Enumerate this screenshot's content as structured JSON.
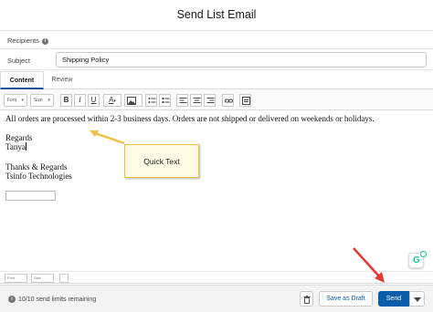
{
  "header": {
    "title": "Send List Email"
  },
  "recipients": {
    "label": "Recipients",
    "info_icon": "i"
  },
  "subject": {
    "label": "Subject",
    "value": "Shipping Policy"
  },
  "tabs": [
    {
      "label": "Content",
      "active": true
    },
    {
      "label": "Review",
      "active": false
    }
  ],
  "toolbar": {
    "font_select": "Font",
    "size_select": "Size",
    "bold": "B",
    "italic": "I",
    "underline": "U",
    "font_color": "A",
    "icons": [
      "image-icon",
      "bullet-list-icon",
      "numbered-list-icon",
      "align-left-icon",
      "align-center-icon",
      "align-right-icon",
      "link-icon",
      "template-icon"
    ]
  },
  "email_body": {
    "line1": "All orders are processed within 2-3 business days. Orders are not shipped or delivered on weekends or holidays.",
    "regards": "Regards",
    "name": "Tanya",
    "thanks": "Thanks & Regards",
    "company": "Tsinfo Technologies"
  },
  "bottom_toolbar": {
    "font_select": "Font",
    "size_select": "Size"
  },
  "annotation": {
    "callout_text": "Quick Text",
    "callout_color": "#f0c04a",
    "arrow_color": "#e53935"
  },
  "footer": {
    "info_icon": "i",
    "send_limits": "10/10 send limits remaining",
    "save_draft_label": "Save as Draft",
    "send_label": "Send"
  },
  "colors": {
    "brand_blue": "#0b5cab",
    "grammarly_green": "#15c39a"
  }
}
